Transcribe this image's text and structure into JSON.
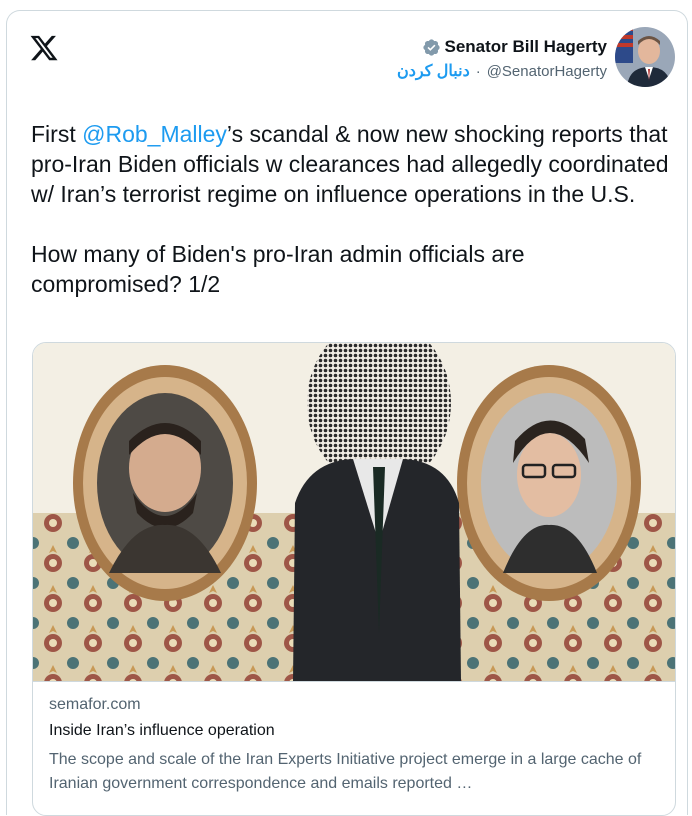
{
  "author": {
    "display_name": "Senator Bill Hagerty",
    "handle": "@SenatorHagerty",
    "follow_label": "دنبال کردن",
    "separator": "·"
  },
  "tweet": {
    "pre_text": "First ",
    "mention": "@Rob_Malley",
    "post_text": "’s scandal & now new shocking reports that pro-Iran Biden officials w clearances had allegedly coordinated w/ Iran’s terrorist regime on influence operations in the U.S.\n\nHow many of Biden's pro-Iran admin officials are compromised? 1/2"
  },
  "link_card": {
    "domain": "semafor.com",
    "title": "Inside Iran’s influence operation",
    "description": "The scope and scale of the Iran Experts Initiative project emerge in a large cache of Iranian government correspondence and emails reported …"
  },
  "icons": {
    "logo": "x-logo-icon",
    "verified": "verified-badge-icon"
  },
  "colors": {
    "accent": "#1d9bf0",
    "text": "#0f1419",
    "secondary": "#536471",
    "border": "#cfd9de"
  }
}
